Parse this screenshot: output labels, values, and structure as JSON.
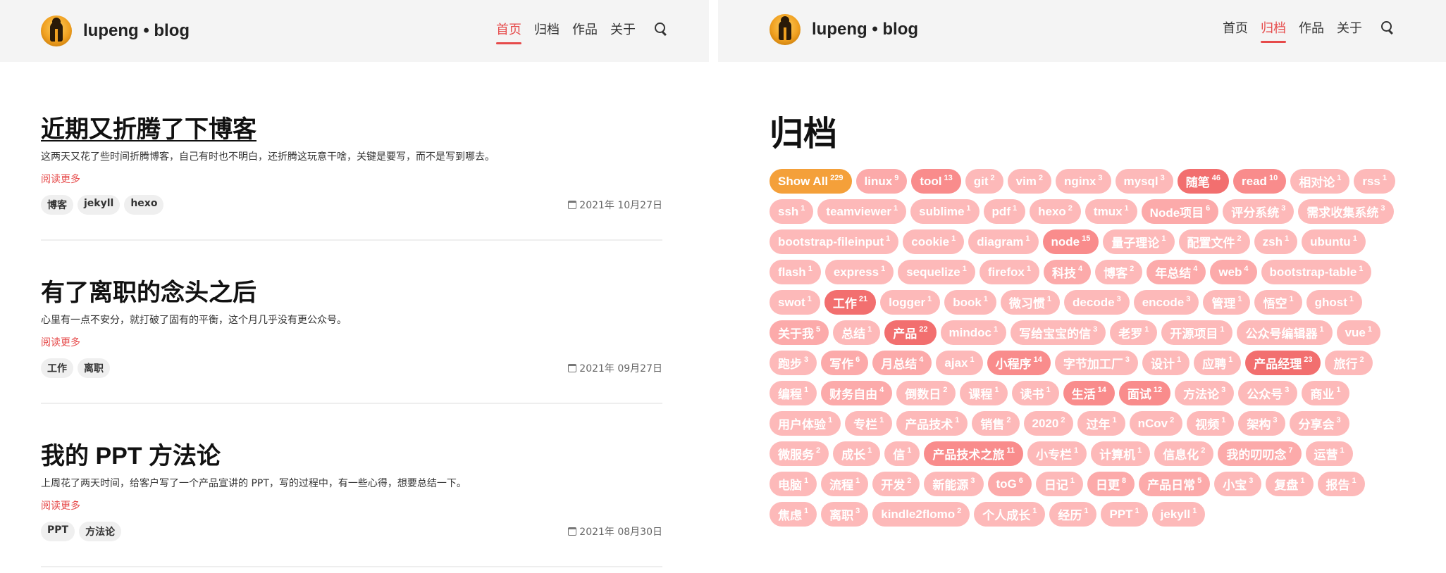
{
  "left": {
    "site_name": "lupeng • blog",
    "nav": [
      "首页",
      "归档",
      "作品",
      "关于"
    ],
    "read_more": "阅读更多",
    "posts": [
      {
        "title": "近期又折腾了下博客",
        "desc": "这两天又花了些时间折腾博客，自己有时也不明白，还折腾这玩意干啥，关键是要写，而不是写到哪去。",
        "tags": [
          "博客",
          "jekyll",
          "hexo"
        ],
        "date": "2021年 10月27日"
      },
      {
        "title": "有了离职的念头之后",
        "desc": "心里有一点不安分，就打破了固有的平衡，这个月几乎没有更公众号。",
        "tags": [
          "工作",
          "离职"
        ],
        "date": "2021年 09月27日"
      },
      {
        "title": "我的 PPT 方法论",
        "desc": "上周花了两天时间，给客户写了一个产品宣讲的 PPT，写的过程中，有一些心得，想要总结一下。",
        "tags": [
          "PPT",
          "方法论"
        ],
        "date": "2021年 08月30日"
      }
    ]
  },
  "right": {
    "site_name": "lupeng • blog",
    "nav": [
      "首页",
      "归档",
      "作品",
      "关于"
    ],
    "page_title": "归档",
    "tags": [
      {
        "name": "Show All",
        "count": 229
      },
      {
        "name": "linux",
        "count": 9
      },
      {
        "name": "tool",
        "count": 13
      },
      {
        "name": "git",
        "count": 2
      },
      {
        "name": "vim",
        "count": 2
      },
      {
        "name": "nginx",
        "count": 3
      },
      {
        "name": "mysql",
        "count": 3
      },
      {
        "name": "随笔",
        "count": 46
      },
      {
        "name": "read",
        "count": 10
      },
      {
        "name": "相对论",
        "count": 1
      },
      {
        "name": "rss",
        "count": 1
      },
      {
        "name": "ssh",
        "count": 1
      },
      {
        "name": "teamviewer",
        "count": 1
      },
      {
        "name": "sublime",
        "count": 1
      },
      {
        "name": "pdf",
        "count": 1
      },
      {
        "name": "hexo",
        "count": 2
      },
      {
        "name": "tmux",
        "count": 1
      },
      {
        "name": "Node项目",
        "count": 6
      },
      {
        "name": "评分系统",
        "count": 3
      },
      {
        "name": "需求收集系统",
        "count": 3
      },
      {
        "name": "bootstrap-fileinput",
        "count": 1
      },
      {
        "name": "cookie",
        "count": 1
      },
      {
        "name": "diagram",
        "count": 1
      },
      {
        "name": "node",
        "count": 15
      },
      {
        "name": "量子理论",
        "count": 1
      },
      {
        "name": "配置文件",
        "count": 2
      },
      {
        "name": "zsh",
        "count": 1
      },
      {
        "name": "ubuntu",
        "count": 1
      },
      {
        "name": "flash",
        "count": 1
      },
      {
        "name": "express",
        "count": 1
      },
      {
        "name": "sequelize",
        "count": 1
      },
      {
        "name": "firefox",
        "count": 1
      },
      {
        "name": "科技",
        "count": 4
      },
      {
        "name": "博客",
        "count": 2
      },
      {
        "name": "年总结",
        "count": 4
      },
      {
        "name": "web",
        "count": 4
      },
      {
        "name": "bootstrap-table",
        "count": 1
      },
      {
        "name": "swot",
        "count": 1
      },
      {
        "name": "工作",
        "count": 21
      },
      {
        "name": "logger",
        "count": 1
      },
      {
        "name": "book",
        "count": 1
      },
      {
        "name": "微习惯",
        "count": 1
      },
      {
        "name": "decode",
        "count": 3
      },
      {
        "name": "encode",
        "count": 3
      },
      {
        "name": "管理",
        "count": 1
      },
      {
        "name": "悟空",
        "count": 1
      },
      {
        "name": "ghost",
        "count": 1
      },
      {
        "name": "关于我",
        "count": 5
      },
      {
        "name": "总结",
        "count": 1
      },
      {
        "name": "产品",
        "count": 22
      },
      {
        "name": "mindoc",
        "count": 1
      },
      {
        "name": "写给宝宝的信",
        "count": 3
      },
      {
        "name": "老罗",
        "count": 1
      },
      {
        "name": "开源项目",
        "count": 1
      },
      {
        "name": "公众号编辑器",
        "count": 1
      },
      {
        "name": "vue",
        "count": 1
      },
      {
        "name": "跑步",
        "count": 3
      },
      {
        "name": "写作",
        "count": 6
      },
      {
        "name": "月总结",
        "count": 4
      },
      {
        "name": "ajax",
        "count": 1
      },
      {
        "name": "小程序",
        "count": 14
      },
      {
        "name": "字节加工厂",
        "count": 3
      },
      {
        "name": "设计",
        "count": 1
      },
      {
        "name": "应聘",
        "count": 1
      },
      {
        "name": "产品经理",
        "count": 23
      },
      {
        "name": "旅行",
        "count": 2
      },
      {
        "name": "编程",
        "count": 1
      },
      {
        "name": "财务自由",
        "count": 4
      },
      {
        "name": "倒数日",
        "count": 2
      },
      {
        "name": "课程",
        "count": 1
      },
      {
        "name": "读书",
        "count": 1
      },
      {
        "name": "生活",
        "count": 14
      },
      {
        "name": "面试",
        "count": 12
      },
      {
        "name": "方法论",
        "count": 3
      },
      {
        "name": "公众号",
        "count": 3
      },
      {
        "name": "商业",
        "count": 1
      },
      {
        "name": "用户体验",
        "count": 1
      },
      {
        "name": "专栏",
        "count": 1
      },
      {
        "name": "产品技术",
        "count": 1
      },
      {
        "name": "销售",
        "count": 2
      },
      {
        "name": "2020",
        "count": 2
      },
      {
        "name": "过年",
        "count": 1
      },
      {
        "name": "nCov",
        "count": 2
      },
      {
        "name": "视频",
        "count": 1
      },
      {
        "name": "架构",
        "count": 3
      },
      {
        "name": "分享会",
        "count": 3
      },
      {
        "name": "微服务",
        "count": 2
      },
      {
        "name": "成长",
        "count": 1
      },
      {
        "name": "信",
        "count": 1
      },
      {
        "name": "产品技术之旅",
        "count": 11
      },
      {
        "name": "小专栏",
        "count": 1
      },
      {
        "name": "计算机",
        "count": 1
      },
      {
        "name": "信息化",
        "count": 2
      },
      {
        "name": "我的叨叨念",
        "count": 7
      },
      {
        "name": "运营",
        "count": 1
      },
      {
        "name": "电脑",
        "count": 1
      },
      {
        "name": "流程",
        "count": 1
      },
      {
        "name": "开发",
        "count": 2
      },
      {
        "name": "新能源",
        "count": 3
      },
      {
        "name": "toG",
        "count": 6
      },
      {
        "name": "日记",
        "count": 1
      },
      {
        "name": "日更",
        "count": 8
      },
      {
        "name": "产品日常",
        "count": 5
      },
      {
        "name": "小宝",
        "count": 3
      },
      {
        "name": "复盘",
        "count": 1
      },
      {
        "name": "报告",
        "count": 1
      },
      {
        "name": "焦虑",
        "count": 1
      },
      {
        "name": "离职",
        "count": 3
      },
      {
        "name": "kindle2flomo",
        "count": 2
      },
      {
        "name": "个人成长",
        "count": 1
      },
      {
        "name": "经历",
        "count": 1
      },
      {
        "name": "PPT",
        "count": 1
      },
      {
        "name": "jekyll",
        "count": 1
      }
    ]
  },
  "colors": {
    "accent": "#e64a4a",
    "show_all": "#f4a03a",
    "tag_light": "#fdb9b9",
    "tag_mid": "#fcaaaa",
    "tag_strong": "#f98c8c",
    "tag_hot": "#f26f6f",
    "navbar_bg": "#f4f4f4"
  }
}
